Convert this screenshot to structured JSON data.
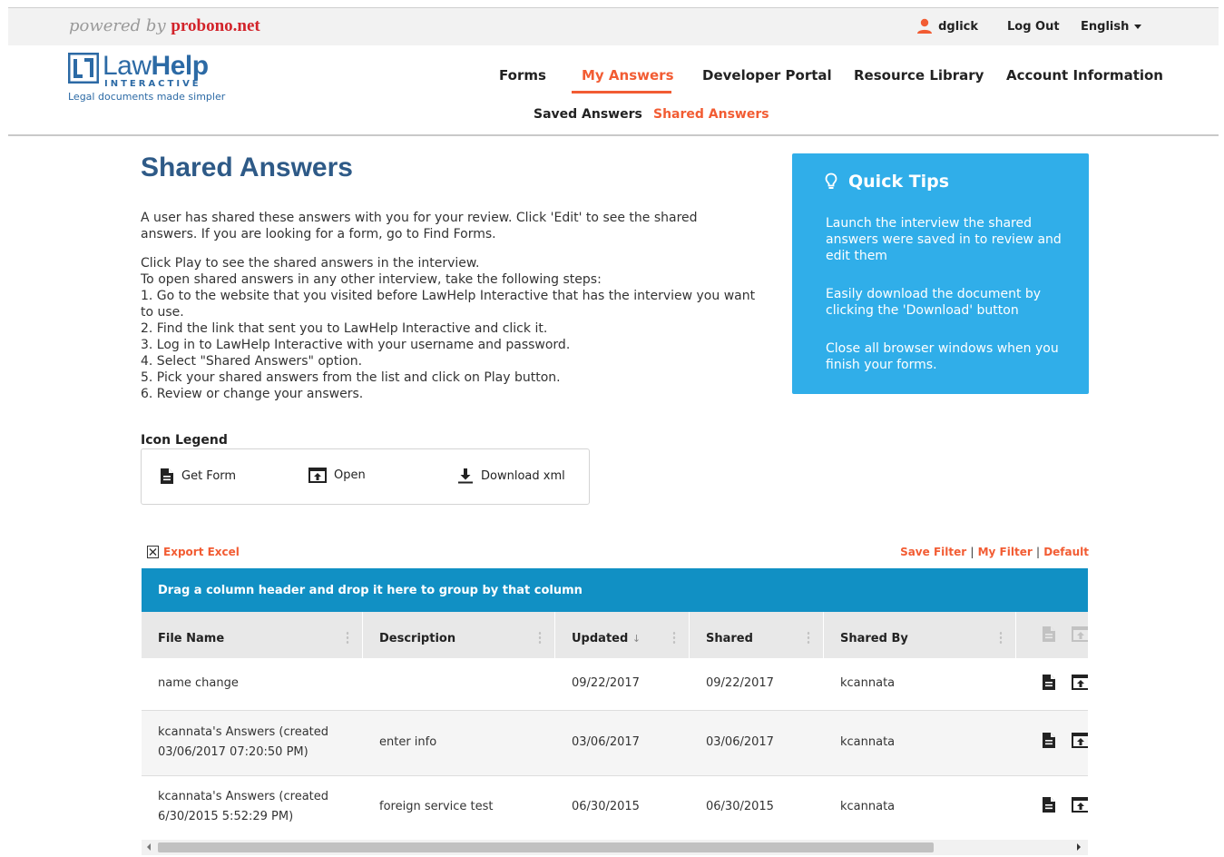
{
  "topbar": {
    "powered_prefix": "powered by",
    "powered_brand": "probono.net",
    "username": "dglick",
    "logout": "Log Out",
    "language": "English"
  },
  "logo": {
    "name_part1": "Law",
    "name_part2": "Help",
    "sub": "INTERACTIVE",
    "tagline": "Legal documents made simpler"
  },
  "nav": {
    "items": [
      {
        "label": "Forms"
      },
      {
        "label": "My Answers"
      },
      {
        "label": "Developer Portal"
      },
      {
        "label": "Resource Library"
      },
      {
        "label": "Account Information"
      }
    ],
    "sub": [
      {
        "label": "Saved Answers"
      },
      {
        "label": "Shared Answers"
      }
    ]
  },
  "page": {
    "title": "Shared Answers",
    "intro": "A user has shared these answers with you for your review. Click 'Edit' to see the shared answers. If you are looking for a form, go to Find Forms.",
    "steps": [
      "Click Play to see the shared answers in the interview.",
      "To open shared answers in any other interview, take the following steps:",
      "1. Go to the website that you visited before LawHelp Interactive that has the interview you want to use.",
      "2. Find the link that sent you to LawHelp Interactive and click it.",
      "3. Log in to LawHelp Interactive with your username and password.",
      "4. Select \"Shared Answers\" option.",
      "5. Pick your shared answers from the list and click on Play button.",
      "6. Review or change your answers."
    ]
  },
  "tips": {
    "title": "Quick Tips",
    "items": [
      "Launch the interview the shared answers were saved in to review and edit them",
      "Easily download the document by clicking the 'Download' button",
      "Close all browser windows when you finish your forms."
    ]
  },
  "legend": {
    "title": "Icon Legend",
    "items": [
      {
        "label": "Get Form",
        "icon": "document-icon"
      },
      {
        "label": "Open",
        "icon": "open-icon"
      },
      {
        "label": "Download xml",
        "icon": "download-icon"
      }
    ]
  },
  "toolbar": {
    "export": "Export Excel",
    "save_filter": "Save Filter",
    "my_filter": "My Filter",
    "default": "Default",
    "sep": "|"
  },
  "grid": {
    "group_hint": "Drag a column header and drop it here to group by that column",
    "columns": [
      "File Name",
      "Description",
      "Updated",
      "Shared",
      "Shared By"
    ],
    "sort_indicator": "↓",
    "rows": [
      {
        "file": "name change",
        "description": "",
        "updated": "09/22/2017",
        "shared": "09/22/2017",
        "shared_by": "kcannata"
      },
      {
        "file": "kcannata's Answers (created 03/06/2017 07:20:50 PM)",
        "description": "enter info",
        "updated": "03/06/2017",
        "shared": "03/06/2017",
        "shared_by": "kcannata"
      },
      {
        "file": "kcannata's Answers (created 6/30/2015 5:52:29 PM)",
        "description": "foreign service test",
        "updated": "06/30/2015",
        "shared": "06/30/2015",
        "shared_by": "kcannata"
      }
    ]
  },
  "colors": {
    "accent": "#f25c33",
    "title_blue": "#2e5a87",
    "tips_bg": "#30aee9",
    "group_bar": "#1190c4"
  }
}
